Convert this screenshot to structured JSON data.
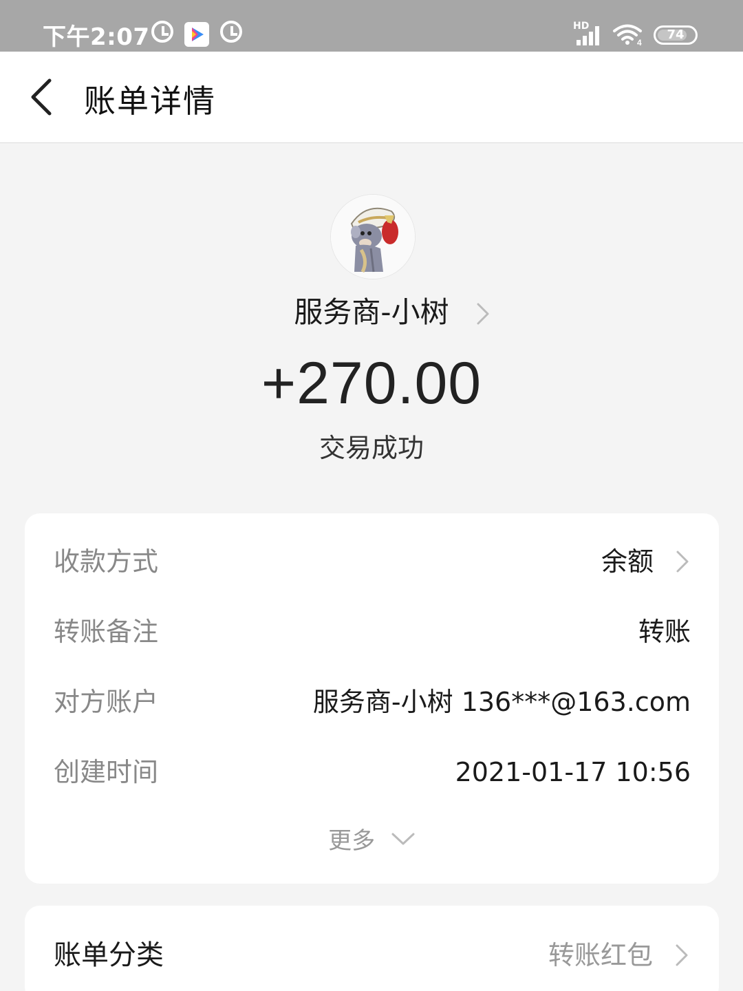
{
  "status_bar": {
    "time": "下午2:07",
    "network": "HD",
    "wifi_badge": "4",
    "battery": "74"
  },
  "header": {
    "title": "账单详情"
  },
  "transaction": {
    "merchant": "服务商-小树",
    "amount": "+270.00",
    "status": "交易成功"
  },
  "details": [
    {
      "label": "收款方式",
      "value": "余额"
    },
    {
      "label": "转账备注",
      "value": "转账"
    },
    {
      "label": "对方账户",
      "value": "服务商-小树 136***@163.com"
    },
    {
      "label": "创建时间",
      "value": "2021-01-17 10:56"
    }
  ],
  "more_label": "更多",
  "category": {
    "label": "账单分类",
    "value": "转账红包"
  },
  "icons": [
    "alarm-icon",
    "video-app-icon",
    "signal-icon",
    "wifi-icon",
    "battery-icon",
    "back-arrow-icon",
    "chevron-right-icon",
    "chevron-down-icon"
  ]
}
